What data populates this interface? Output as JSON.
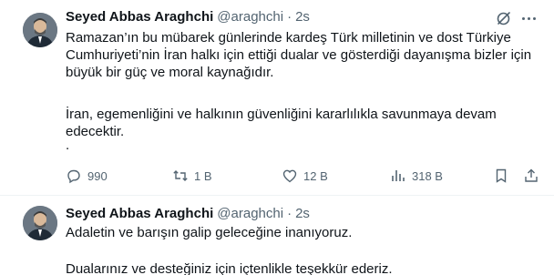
{
  "tweets": [
    {
      "author_name": "Seyed Abbas Araghchi",
      "handle": "@araghchi",
      "separator": "·",
      "time": "2s",
      "paragraphs": [
        "Ramazan’ın bu mübarek günlerinde kardeş Türk milletinin ve dost Türkiye Cumhuriyeti’nin İran halkı için ettiği dualar ve gösterdiği dayanışma bizler için büyük bir güç ve moral kaynağıdır.",
        "İran, egemenliğini ve halkının güvenliğini kararlılıkla savunmaya devam edecektir.",
        "."
      ],
      "actions": {
        "replies": "990",
        "retweets": "1 B",
        "likes": "12 B",
        "views": "318 B"
      }
    },
    {
      "author_name": "Seyed Abbas Araghchi",
      "handle": "@araghchi",
      "separator": "·",
      "time": "2s",
      "paragraphs": [
        "Adaletin ve barışın galip geleceğine inanıyoruz.",
        "Dualarınız ve desteğiniz için içtenlikle teşekkür ederiz."
      ]
    }
  ],
  "icons": {
    "grok": "grok-icon",
    "more": "more-icon",
    "reply": "reply-icon",
    "retweet": "retweet-icon",
    "like": "heart-icon",
    "views": "views-icon",
    "bookmark": "bookmark-icon",
    "share": "share-icon"
  },
  "colors": {
    "text": "#0f1419",
    "secondary": "#536471",
    "divider": "#eff3f4"
  }
}
